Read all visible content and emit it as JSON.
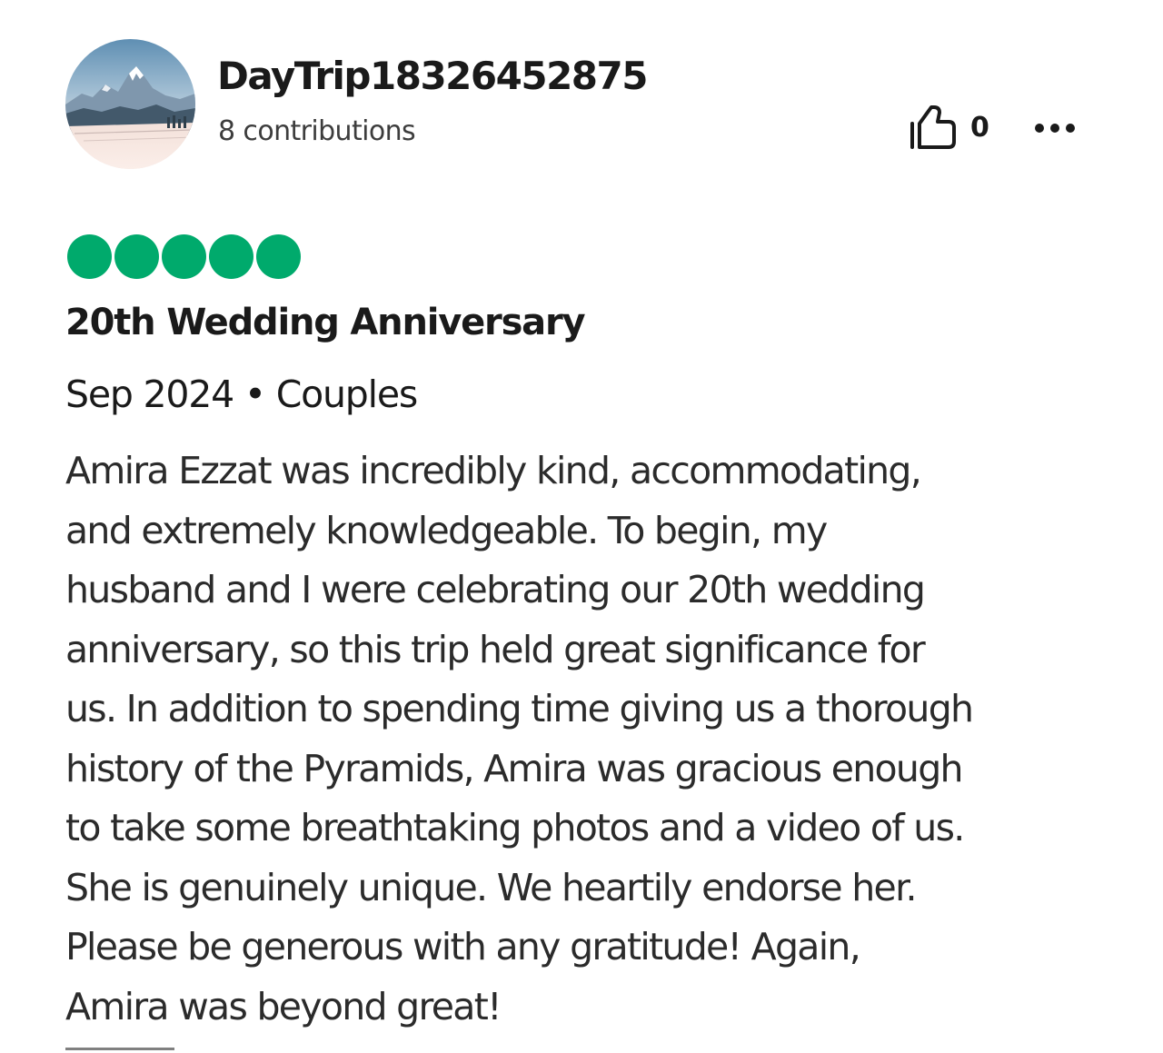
{
  "review": {
    "user": {
      "name": "DayTrip18326452875",
      "contributions": "8 contributions",
      "avatar": "mountain-landscape-avatar"
    },
    "actions": {
      "helpful_icon": "thumbs-up-icon",
      "helpful_count": "0",
      "more_icon": "more-options-icon"
    },
    "rating": {
      "value": 5,
      "max": 5,
      "color": "#00aa6c"
    },
    "title": "20th Wedding Anniversary",
    "meta": "Sep 2024 • Couples",
    "body_lines": [
      "Amira Ezzat was incredibly kind, accommodating,",
      "and extremely knowledgeable. To begin, my",
      "husband and I were celebrating our 20th wedding",
      "anniversary, so this trip held great significance for",
      "us. In addition to spending time giving us a thorough",
      "history of the Pyramids, Amira was gracious enough",
      "to take some breathtaking photos and a video of us.",
      "She is genuinely unique. We heartily endorse her.",
      "Please be generous with any gratitude! Again,",
      "Amira was beyond great!"
    ]
  }
}
